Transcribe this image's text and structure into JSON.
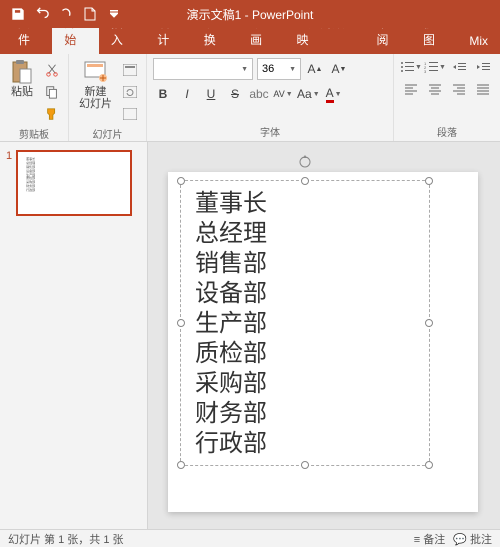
{
  "app": {
    "title": "演示文稿1 - PowerPoint"
  },
  "tabs": {
    "file": "文件",
    "home": "开始",
    "insert": "插入",
    "design": "设计",
    "transition": "切换",
    "animation": "动画",
    "slideshow": "幻灯片放映",
    "review": "审阅",
    "view": "视图",
    "mix": "Mix"
  },
  "ribbon": {
    "clipboard": {
      "label": "剪贴板",
      "paste": "粘贴"
    },
    "slides": {
      "label": "幻灯片",
      "new_slide": "新建\n幻灯片"
    },
    "font": {
      "label": "字体",
      "size": "36",
      "name_placeholder": ""
    },
    "paragraph": {
      "label": "段落"
    }
  },
  "textbox": {
    "lines": [
      "董事长",
      "总经理",
      "销售部",
      "设备部",
      "生产部",
      "质检部",
      "采购部",
      "财务部",
      "行政部"
    ]
  },
  "thumb": {
    "number": "1"
  },
  "status": {
    "left": "幻灯片 第 1 张，共 1 张",
    "notes": "备注",
    "comments": "批注"
  }
}
